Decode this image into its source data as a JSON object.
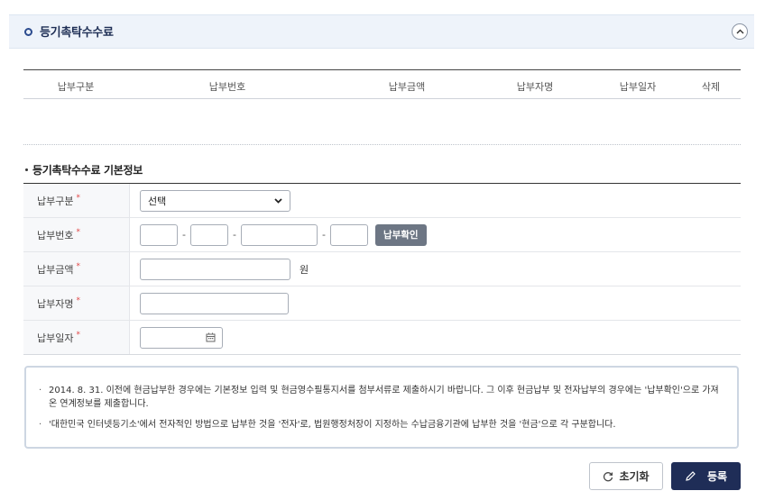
{
  "header": {
    "title": "등기촉탁수수료"
  },
  "list": {
    "columns": [
      "납부구분",
      "납부번호",
      "납부금액",
      "납부자명",
      "납부일자",
      "삭제"
    ]
  },
  "section": {
    "title": "등기촉탁수수료 기본정보"
  },
  "form": {
    "type_label": "납부구분",
    "type_selected": "선택",
    "number_label": "납부번호",
    "check_button": "납부확인",
    "amount_label": "납부금액",
    "amount_unit": "원",
    "payer_label": "납부자명",
    "date_label": "납부일자",
    "required_mark": "*"
  },
  "notice": {
    "items": [
      "2014. 8. 31. 이전에 현금납부한 경우에는 기본정보 입력 및 현금영수필통지서를 첨부서류로 제출하시기 바랍니다. 그 이후 현금납부 및 전자납부의 경우에는 '납부확인'으로 가져온 연계정보를 제출합니다.",
      "'대한민국 인터넷등기소'에서 전자적인 방법으로 납부한 것을 '전자'로, 법원행정처장이 지정하는 수납금융기관에 납부한 것을 '현금'으로 각 구분합니다."
    ]
  },
  "buttons": {
    "reset": "초기화",
    "submit": "등록"
  },
  "colors": {
    "primary": "#1f2d57",
    "required": "#e04848",
    "check_button": "#6d7684"
  }
}
